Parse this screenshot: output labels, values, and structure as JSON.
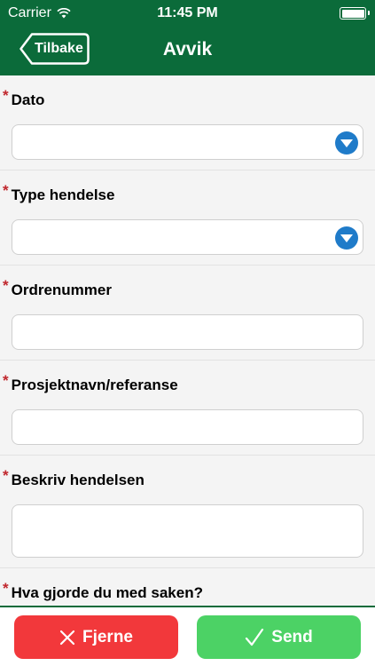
{
  "status_bar": {
    "carrier": "Carrier",
    "time": "11:45 PM"
  },
  "nav": {
    "back_label": "Tilbake",
    "title": "Avvik"
  },
  "form": {
    "fields": [
      {
        "label": "Dato",
        "required_mark": "*",
        "type": "select",
        "value": ""
      },
      {
        "label": "Type hendelse",
        "required_mark": "*",
        "type": "select",
        "value": ""
      },
      {
        "label": "Ordrenummer",
        "required_mark": "*",
        "type": "text",
        "value": ""
      },
      {
        "label": "Prosjektnavn/referanse",
        "required_mark": "*",
        "type": "text",
        "value": ""
      },
      {
        "label": "Beskriv hendelsen",
        "required_mark": "*",
        "type": "textarea",
        "value": ""
      },
      {
        "label": "Hva gjorde du med saken?",
        "required_mark": "*",
        "type": "textarea",
        "value": ""
      }
    ]
  },
  "actions": {
    "remove_label": "Fjerne",
    "send_label": "Send"
  },
  "colors": {
    "header": "#0b6b3a",
    "required_star": "#c0272d",
    "dropdown": "#1f7bc9",
    "remove": "#f2383b",
    "send": "#4cd265"
  },
  "icons": [
    "wifi-icon",
    "battery-icon",
    "back-chevron-icon",
    "chevron-down-icon",
    "x-icon",
    "checkmark-icon"
  ]
}
